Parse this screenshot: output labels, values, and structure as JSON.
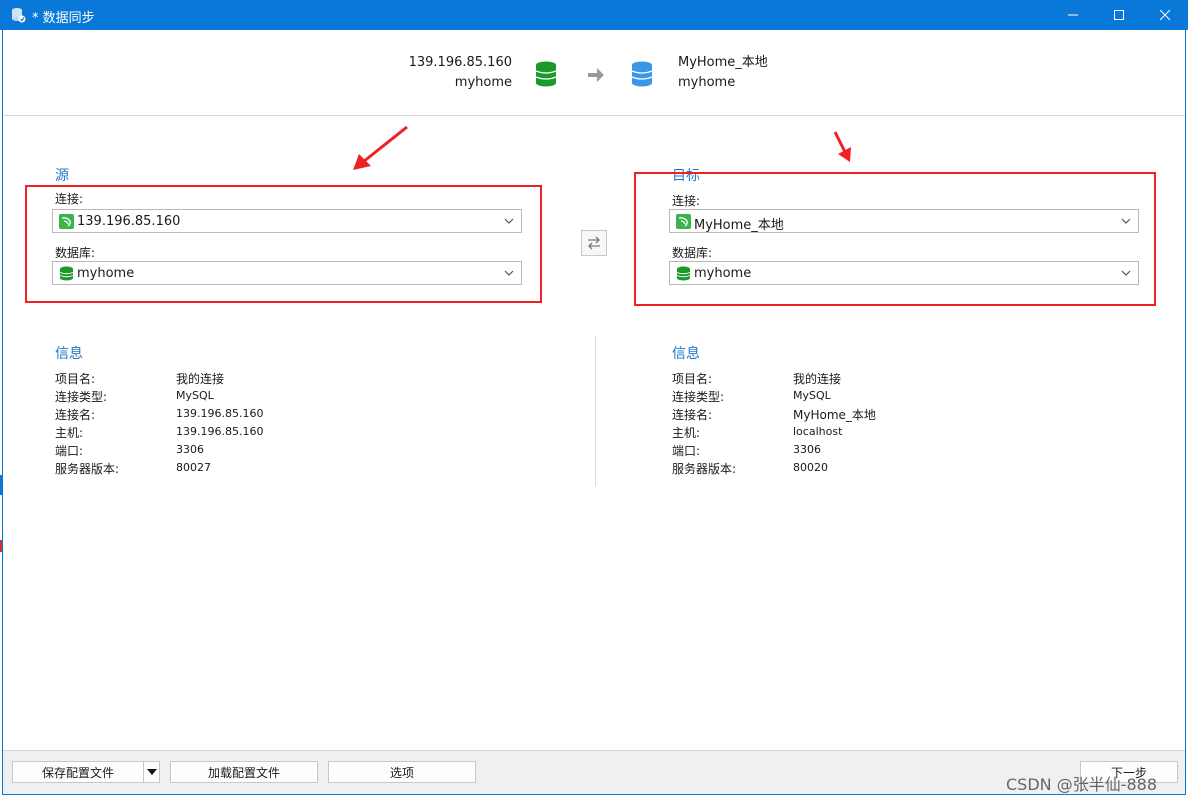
{
  "window": {
    "title": "* 数据同步"
  },
  "header": {
    "source": {
      "host": "139.196.85.160",
      "database": "myhome"
    },
    "target": {
      "host": "MyHome_本地",
      "database": "myhome"
    },
    "colors": {
      "source_db": "#1a9a2a",
      "target_db": "#3a96e6",
      "arrow": "#9a9a9a"
    }
  },
  "source": {
    "section_title": "源",
    "connection_label": "连接:",
    "connection_value": "139.196.85.160",
    "database_label": "数据库:",
    "database_value": "myhome"
  },
  "target": {
    "section_title": "目标",
    "connection_label": "连接:",
    "connection_value": "MyHome_本地",
    "database_label": "数据库:",
    "database_value": "myhome"
  },
  "source_info": {
    "title": "信息",
    "rows": [
      {
        "key": "项目名:",
        "value": "我的连接"
      },
      {
        "key": "连接类型:",
        "value": "MySQL"
      },
      {
        "key": "连接名:",
        "value": "139.196.85.160"
      },
      {
        "key": "主机:",
        "value": "139.196.85.160"
      },
      {
        "key": "端口:",
        "value": "3306"
      },
      {
        "key": "服务器版本:",
        "value": "80027"
      }
    ]
  },
  "target_info": {
    "title": "信息",
    "rows": [
      {
        "key": "项目名:",
        "value": "我的连接"
      },
      {
        "key": "连接类型:",
        "value": "MySQL"
      },
      {
        "key": "连接名:",
        "value": "MyHome_本地"
      },
      {
        "key": "主机:",
        "value": "localhost"
      },
      {
        "key": "端口:",
        "value": "3306"
      },
      {
        "key": "服务器版本:",
        "value": "80020"
      }
    ]
  },
  "footer": {
    "save_profile": "保存配置文件",
    "load_profile": "加载配置文件",
    "options": "选项",
    "next": "下一步"
  },
  "watermark": "CSDN @张半仙-888",
  "accent": "#0a78d8",
  "highlight": "#ee2222"
}
